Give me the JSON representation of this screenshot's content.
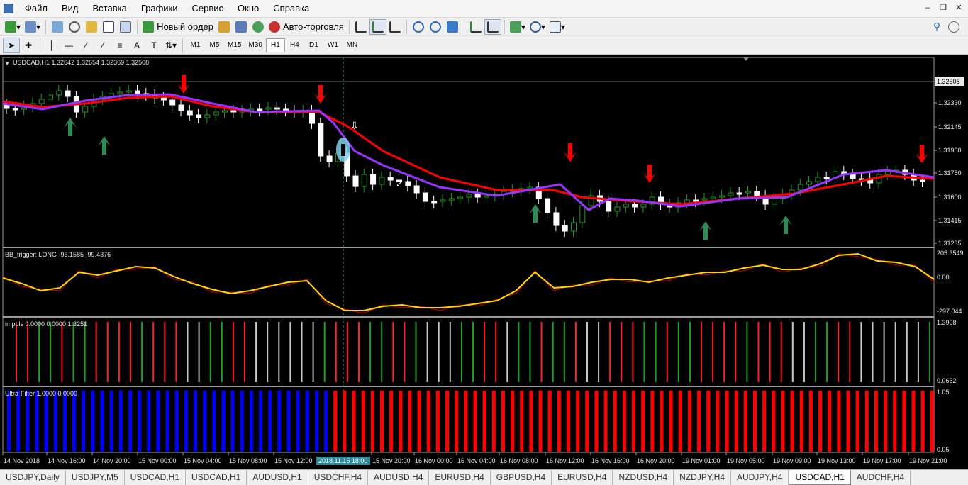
{
  "menu": [
    "Файл",
    "Вид",
    "Вставка",
    "Графики",
    "Сервис",
    "Окно",
    "Справка"
  ],
  "toolbar": {
    "new_order": "Новый ордер",
    "auto_trading": "Авто-торговля"
  },
  "timeframes": [
    "M1",
    "M5",
    "M15",
    "M30",
    "H1",
    "H4",
    "D1",
    "W1",
    "MN"
  ],
  "active_timeframe": "H1",
  "chart": {
    "header": "USDCAD,H1  1.32642 1.32654 1.32369 1.32508",
    "current_price": "1.32508",
    "price_labels": [
      "1.32330",
      "1.32145",
      "1.31960",
      "1.31780",
      "1.31600",
      "1.31415",
      "1.31235"
    ],
    "crosshair_time": "2018.11.15 18:00",
    "time_labels": [
      "14 Nov 2018",
      "14 Nov 16:00",
      "14 Nov 20:00",
      "15 Nov 00:00",
      "15 Nov 04:00",
      "15 Nov 08:00",
      "15 Nov 12:00",
      "15 Nov 20:00",
      "16 Nov 00:00",
      "16 Nov 04:00",
      "16 Nov 08:00",
      "16 Nov 12:00",
      "16 Nov 16:00",
      "16 Nov 20:00",
      "19 Nov 01:00",
      "19 Nov 05:00",
      "19 Nov 09:00",
      "19 Nov 13:00",
      "19 Nov 17:00",
      "19 Nov 21:00"
    ]
  },
  "indicators": {
    "bb": {
      "label": "BB_trigger: LONG -93.1585 -99.4376",
      "scale": [
        "205.3549",
        "0.00",
        "-297.044"
      ]
    },
    "impuls": {
      "label": "impuls 0.0000 0.0000 1.3251",
      "scale": [
        "1.3908",
        "0.0662"
      ]
    },
    "ultra": {
      "label": "Ultra-Filter 1.0000 0.0000",
      "scale": [
        "1.05",
        "0.05"
      ]
    }
  },
  "colors": {
    "up_arrow": "#2e8b57",
    "down_arrow": "#ff0000",
    "ma_fast": "#9933ff",
    "ma_slow": "#ff0000",
    "bb_signal": "#ffd700",
    "bars_blue": "#0000ff",
    "bars_red": "#ff0000"
  },
  "tabs": [
    "USDJPY,Daily",
    "USDJPY,M5",
    "USDCAD,H1",
    "USDCAD,H1",
    "AUDUSD,H1",
    "USDCHF,H4",
    "AUDUSD,H4",
    "EURUSD,H4",
    "GBPUSD,H4",
    "EURUSD,H4",
    "NZDUSD,H4",
    "NZDJPY,H4",
    "AUDJPY,H4",
    "USDCAD,H1",
    "AUDCHF,H4"
  ],
  "active_tab": 13
}
